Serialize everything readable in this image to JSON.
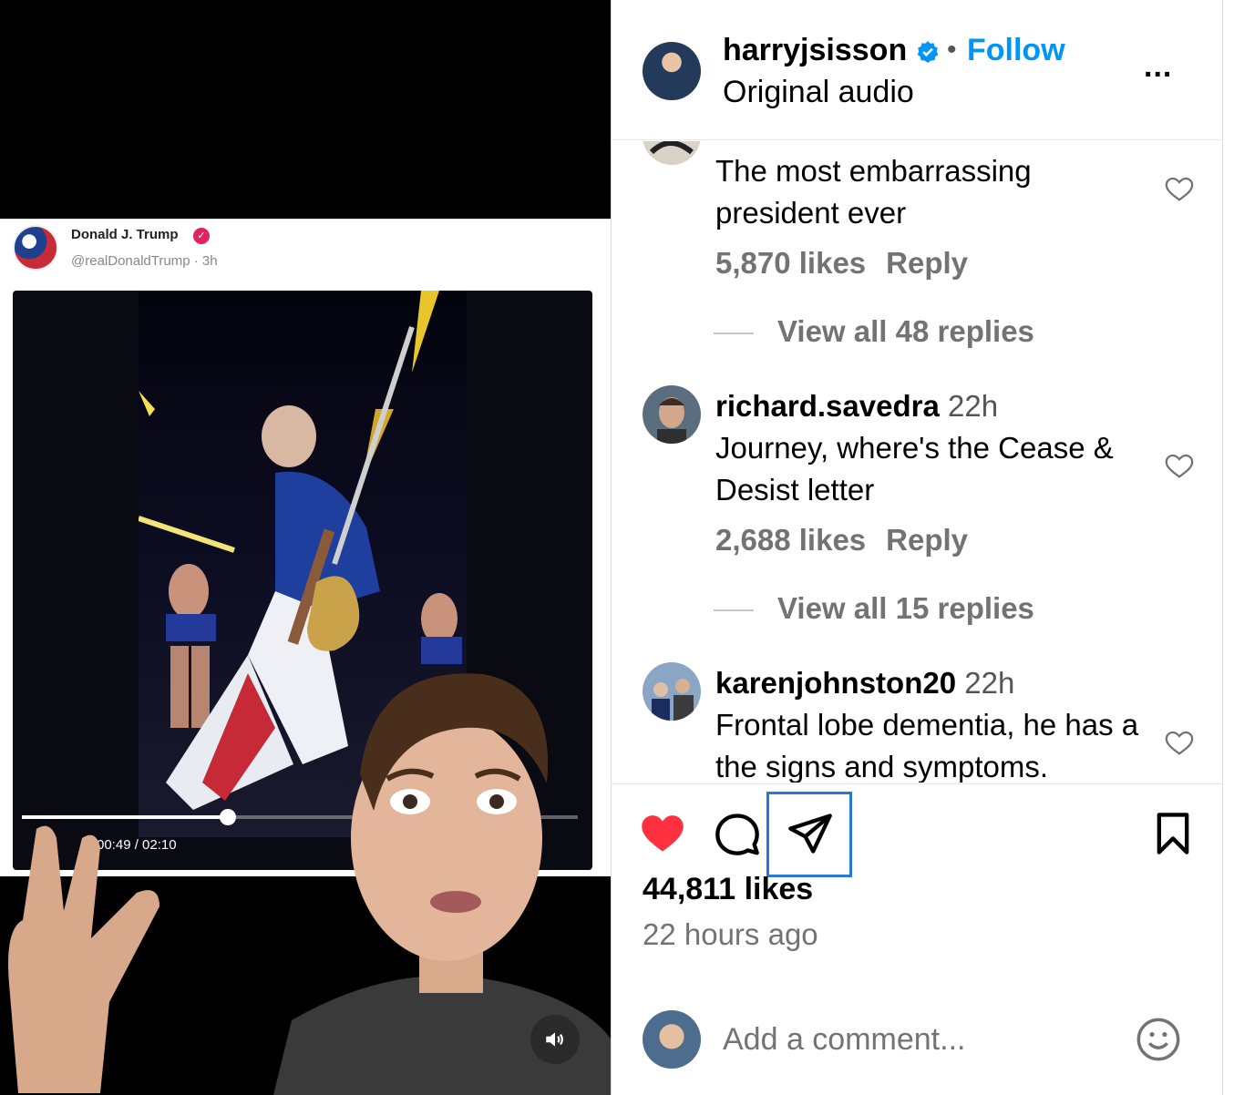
{
  "embedded_post": {
    "author_name": "Donald J. Trump",
    "author_handle": "@realDonaldTrump · 3h",
    "video_time": "00:49 / 02:10",
    "video_progress": 0.37
  },
  "header": {
    "username": "harryjsisson",
    "separator": "•",
    "follow_label": "Follow",
    "audio_label": "Original audio",
    "more_label": "..."
  },
  "comments": [
    {
      "text": "The most embarrassing president ever",
      "likes": "5,870 likes",
      "reply_label": "Reply",
      "view_replies": "View all 48 replies"
    },
    {
      "username": "richard.savedra",
      "time": "22h",
      "text": "Journey, where's the Cease & Desist letter",
      "likes": "2,688 likes",
      "reply_label": "Reply",
      "view_replies": "View all 15 replies"
    },
    {
      "username": "karenjohnston20",
      "time": "22h",
      "text": "Frontal lobe dementia, he has a the signs and symptoms."
    }
  ],
  "footer": {
    "likes_count": "44,811 likes",
    "time_ago": "22 hours ago",
    "comment_placeholder": "Add a comment..."
  },
  "colors": {
    "accent": "#0095f6",
    "like": "#ff3040",
    "verified": "#0095f6",
    "highlight": "#2a78d6"
  },
  "icons": [
    "heart-icon",
    "comment-icon",
    "share-icon",
    "bookmark-icon",
    "emoji-icon",
    "volume-icon",
    "verified-icon"
  ]
}
